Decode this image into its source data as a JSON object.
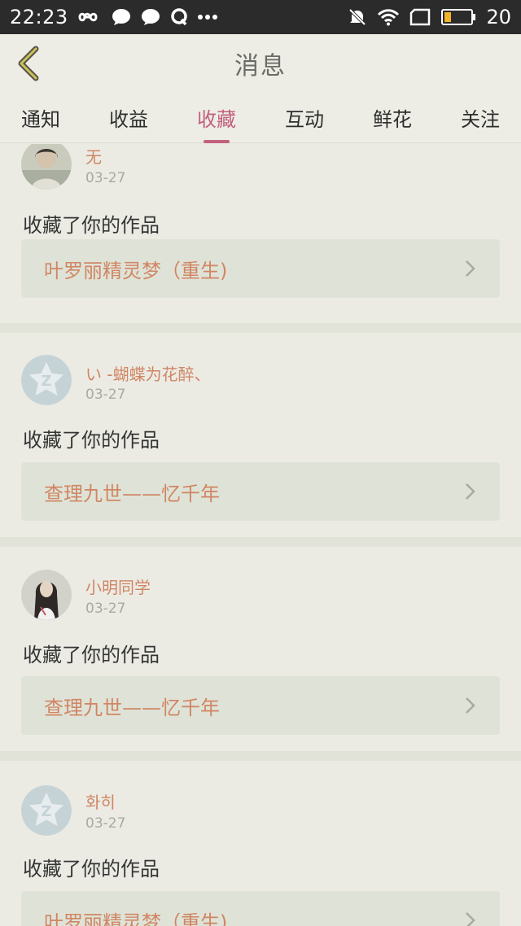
{
  "status_bar": {
    "time": "22:23",
    "battery": "20",
    "icons_left": [
      "infinity-icon",
      "message-bubble-icon",
      "chat-bubble-icon",
      "qq-icon",
      "more-dots-icon"
    ],
    "icons_right": [
      "mute-icon",
      "wifi-icon",
      "screen-icon",
      "battery-icon"
    ]
  },
  "header": {
    "title": "消息",
    "back_icon": "back-chevron-icon"
  },
  "tabs": [
    {
      "label": "通知",
      "active": false
    },
    {
      "label": "收益",
      "active": false
    },
    {
      "label": "收藏",
      "active": true
    },
    {
      "label": "互动",
      "active": false
    },
    {
      "label": "鲜花",
      "active": false
    },
    {
      "label": "关注",
      "active": false
    }
  ],
  "colors": {
    "accent": "#c2607e",
    "link": "#d08664",
    "card_bg": "#ebebe4",
    "work_bg": "#dfe3d7",
    "statusbar_bg": "#2b2b2b"
  },
  "messages": [
    {
      "user": "无",
      "date": "03-27",
      "action": "收藏了你的作品",
      "work_title": "叶罗丽精灵梦（重生)",
      "avatar": "photo-avatar"
    },
    {
      "user": "い -蝴蝶为花醉、",
      "date": "03-27",
      "action": "收藏了你的作品",
      "work_title": "查理九世——忆千年",
      "avatar": "default-star-avatar"
    },
    {
      "user": "小明同学",
      "date": "03-27",
      "action": "收藏了你的作品",
      "work_title": "查理九世——忆千年",
      "avatar": "photo-avatar"
    },
    {
      "user": "화히",
      "date": "03-27",
      "action": "收藏了你的作品",
      "work_title": "叶罗丽精灵梦（重生)",
      "avatar": "default-star-avatar"
    }
  ]
}
